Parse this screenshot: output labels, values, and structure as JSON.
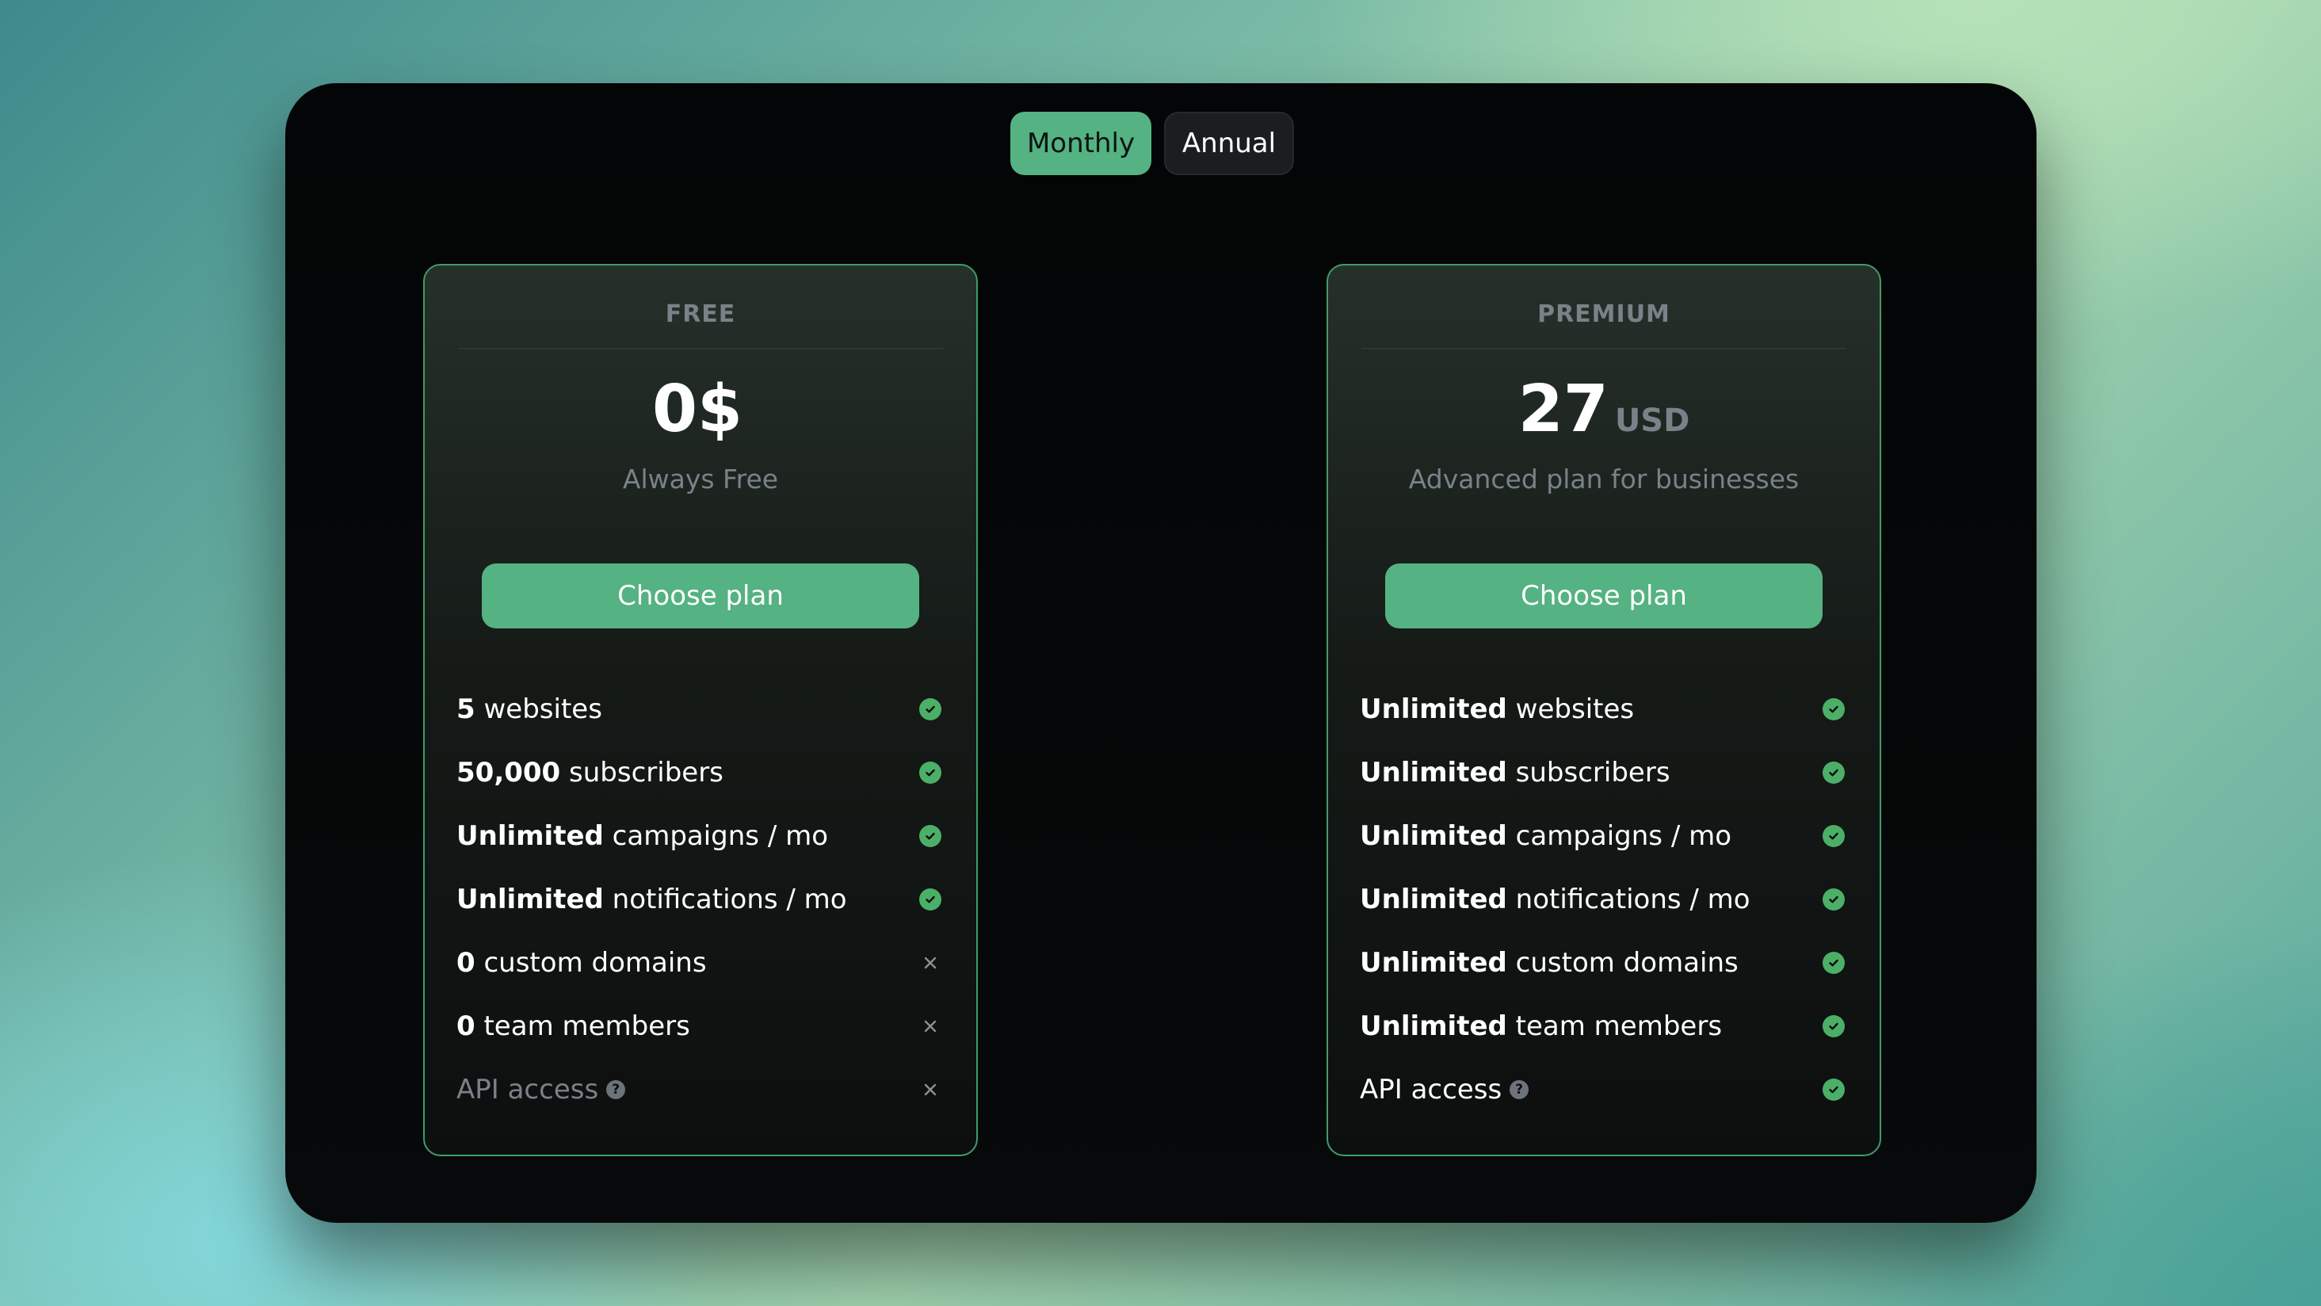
{
  "billing_toggle": {
    "monthly_label": "Monthly",
    "annual_label": "Annual",
    "selected": "Monthly"
  },
  "plans": [
    {
      "tier": "FREE",
      "price": "0$",
      "price_unit": "",
      "subtitle": "Always Free",
      "cta": "Choose plan",
      "features": [
        {
          "strong": "5",
          "text": " websites",
          "included": true
        },
        {
          "strong": "50,000",
          "text": " subscribers",
          "included": true
        },
        {
          "strong": "Unlimited",
          "text": " campaigns / mo",
          "included": true
        },
        {
          "strong": "Unlimited",
          "text": " notifications / mo",
          "included": true
        },
        {
          "strong": "0",
          "text": " custom domains",
          "included": false
        },
        {
          "strong": "0",
          "text": " team members",
          "included": false
        },
        {
          "strong": "",
          "text": "API access",
          "included": false,
          "help": "?"
        }
      ]
    },
    {
      "tier": "PREMIUM",
      "price": "27",
      "price_unit": "USD",
      "subtitle": "Advanced plan for businesses",
      "cta": "Choose plan",
      "features": [
        {
          "strong": "Unlimited",
          "text": " websites",
          "included": true
        },
        {
          "strong": "Unlimited",
          "text": " subscribers",
          "included": true
        },
        {
          "strong": "Unlimited",
          "text": " campaigns / mo",
          "included": true
        },
        {
          "strong": "Unlimited",
          "text": " notifications / mo",
          "included": true
        },
        {
          "strong": "Unlimited",
          "text": " custom domains",
          "included": true
        },
        {
          "strong": "Unlimited",
          "text": " team members",
          "included": true
        },
        {
          "strong": "",
          "text": "API access",
          "included": true,
          "help": "?"
        }
      ]
    }
  ],
  "colors": {
    "accent": "#54b283",
    "check": "#4caf67",
    "muted_text": "#7a8188",
    "card_border": "#3f9c6b"
  },
  "icons": {
    "included": "check-circle-icon",
    "excluded": "x-icon",
    "help": "question-circle-icon"
  }
}
